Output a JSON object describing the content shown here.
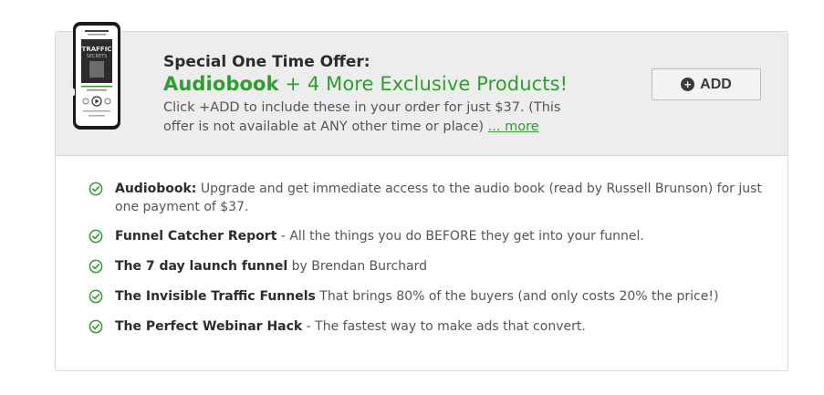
{
  "offer": {
    "title": "Special One Time Offer:",
    "headline_bold": "Audiobook",
    "headline_rest": " + 4 More Exclusive Products!",
    "description": "Click +ADD to include these in your order for just $37. (This offer is not available at ANY other time or place) ",
    "more_link": "... more",
    "add_button": "ADD",
    "accent_color": "#2e9e2e"
  },
  "product_image": {
    "icon": "audiobook-phone-mockup",
    "cover_title": "TRAFFIC",
    "cover_subtitle": "SECRETS"
  },
  "benefits": [
    {
      "name": "Audiobook:",
      "text": " Upgrade and get immediate access to the audio book (read by Russell Brunson) for just one payment of $37."
    },
    {
      "name": "Funnel Catcher Report",
      "text": " - All the things you do BEFORE they get into your funnel."
    },
    {
      "name": "The 7 day launch funnel",
      "text": " by Brendan Burchard"
    },
    {
      "name": "The Invisible Traffic Funnels",
      "text": " That brings 80% of the buyers (and only costs 20% the price!)"
    },
    {
      "name": "The Perfect Webinar Hack",
      "text": " - The fastest way to make ads that convert."
    }
  ]
}
